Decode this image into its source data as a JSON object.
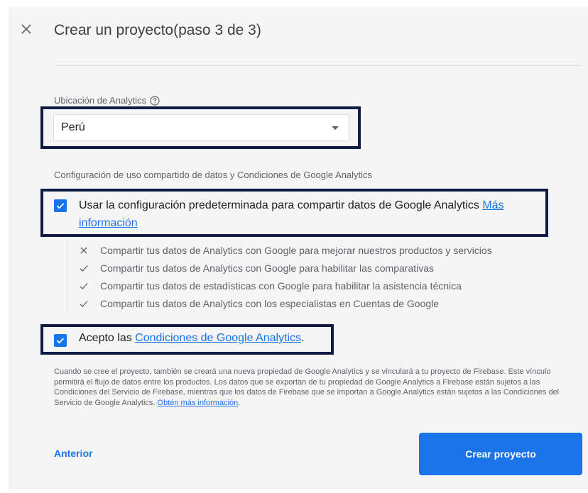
{
  "dialog": {
    "title": "Crear un proyecto(paso 3 de 3)"
  },
  "location": {
    "label": "Ubicación de Analytics",
    "selected": "Perú"
  },
  "sharing": {
    "section_label": "Configuración de uso compartido de datos y Condiciones de Google Analytics",
    "default_text": "Usar la configuración predeterminada para compartir datos de Google Analytics",
    "default_link": "Más información",
    "default_checked": true,
    "items": [
      {
        "icon": "x-icon",
        "label": "Compartir tus datos de Analytics con Google para mejorar nuestros productos y servicios"
      },
      {
        "icon": "check-icon",
        "label": "Compartir tus datos de Analytics con Google para habilitar las comparativas"
      },
      {
        "icon": "check-icon",
        "label": "Compartir tus datos de estadísticas con Google para habilitar la asistencia técnica"
      },
      {
        "icon": "check-icon",
        "label": "Compartir tus datos de Analytics con los especialistas en Cuentas de Google"
      }
    ]
  },
  "terms": {
    "prefix": "Acepto las ",
    "link": "Condiciones de Google Analytics",
    "suffix": ".",
    "checked": true
  },
  "disclaimer": {
    "text": "Cuando se cree el proyecto, también se creará una nueva propiedad de Google Analytics y se vinculará a tu proyecto de Firebase. Este vínculo permitirá el flujo de datos entre los productos. Los datos que se exportan de tu propiedad de Google Analytics a Firebase están sujetos a las Condiciones del Servicio de Firebase, mientras que los datos de Firebase que se importan a Google Analytics están sujetos a las Condiciones del Servicio de Google Analytics.",
    "link": "Obtén más información",
    "suffix": "."
  },
  "actions": {
    "back_label": "Anterior",
    "create_label": "Crear proyecto"
  },
  "colors": {
    "accent": "#1a73e8",
    "highlight_border": "#101c44",
    "panel_bg": "#f5f5f5"
  }
}
